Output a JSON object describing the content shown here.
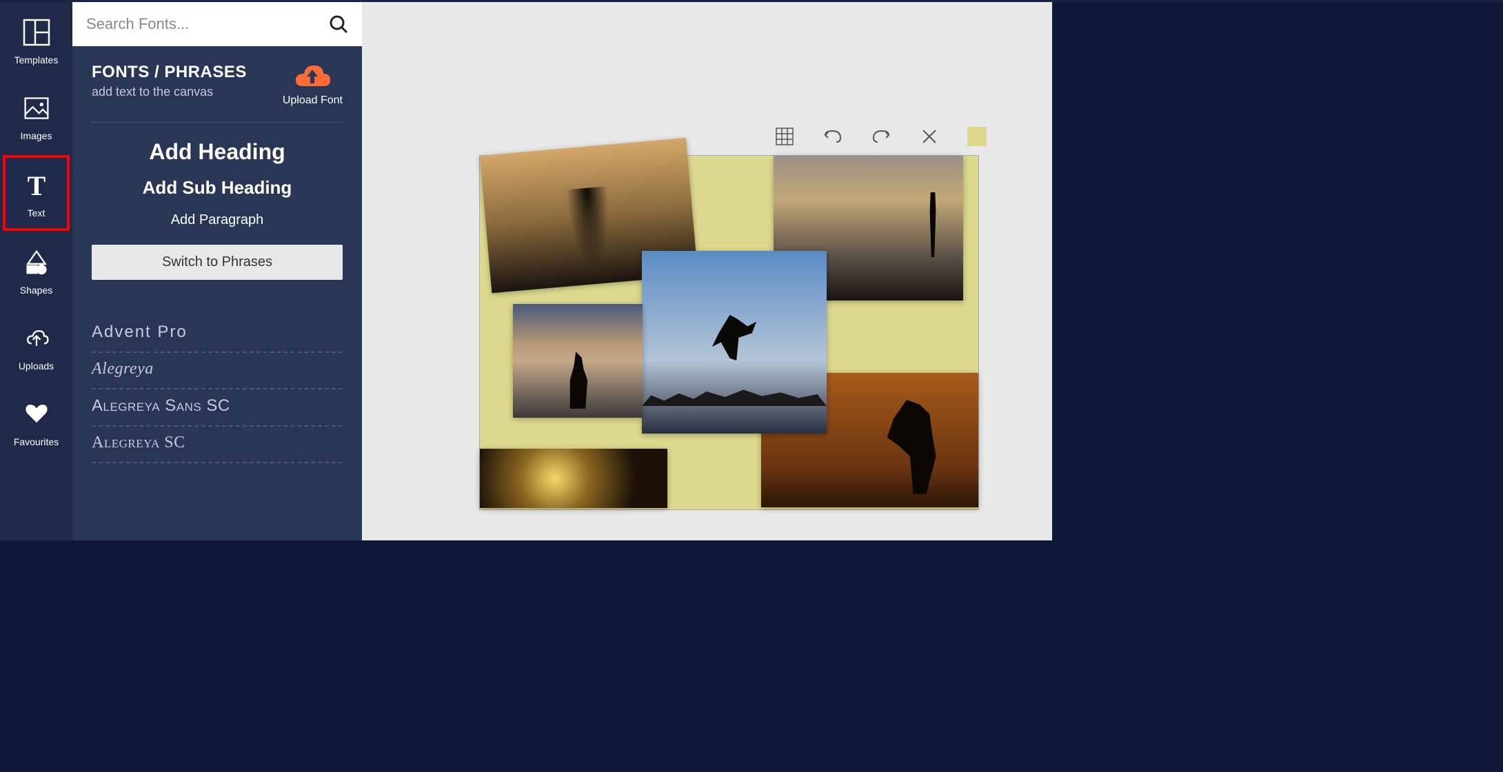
{
  "nav": {
    "items": [
      {
        "label": "Templates",
        "icon": "templates-icon"
      },
      {
        "label": "Images",
        "icon": "images-icon"
      },
      {
        "label": "Text",
        "icon": "text-icon",
        "active": true
      },
      {
        "label": "Shapes",
        "icon": "shapes-icon"
      },
      {
        "label": "Uploads",
        "icon": "uploads-icon"
      },
      {
        "label": "Favourites",
        "icon": "favourites-icon"
      }
    ]
  },
  "search": {
    "placeholder": "Search Fonts..."
  },
  "panel": {
    "title": "FONTS / PHRASES",
    "subtitle": "add text to the canvas",
    "upload_label": "Upload Font",
    "add_heading": "Add Heading",
    "add_subheading": "Add Sub Heading",
    "add_paragraph": "Add Paragraph",
    "switch_btn": "Switch to Phrases"
  },
  "fonts": [
    "Advent Pro",
    "Alegreya",
    "Alegreya Sans SC",
    "Alegreya SC"
  ],
  "toolbar": {
    "grid": "grid-icon",
    "undo": "undo-icon",
    "redo": "redo-icon",
    "close": "close-icon",
    "color": "#dcd98e"
  },
  "canvas": {
    "background": "#dcd98e"
  }
}
